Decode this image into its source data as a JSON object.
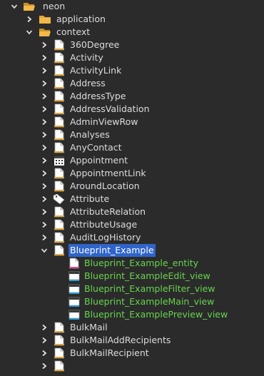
{
  "colors": {
    "background": "#2b2b2b",
    "text": "#dcdcdc",
    "selection": "#2f65ca",
    "generated_text": "#66d54d",
    "folder": "#e0a53a"
  },
  "rows": [
    {
      "label": "neon",
      "depth": 0,
      "arrow": "expanded",
      "icon": "folder-open-icon",
      "style": "normal"
    },
    {
      "label": "application",
      "depth": 1,
      "arrow": "collapsed",
      "icon": "folder-icon",
      "style": "normal"
    },
    {
      "label": "context",
      "depth": 1,
      "arrow": "expanded",
      "icon": "folder-open-icon",
      "style": "normal"
    },
    {
      "label": "360Degree",
      "depth": 2,
      "arrow": "collapsed",
      "icon": "context-icon",
      "style": "normal"
    },
    {
      "label": "Activity",
      "depth": 2,
      "arrow": "collapsed",
      "icon": "context-icon",
      "style": "normal"
    },
    {
      "label": "ActivityLink",
      "depth": 2,
      "arrow": "collapsed",
      "icon": "context-icon",
      "style": "normal"
    },
    {
      "label": "Address",
      "depth": 2,
      "arrow": "collapsed",
      "icon": "context-icon",
      "style": "normal"
    },
    {
      "label": "AddressType",
      "depth": 2,
      "arrow": "collapsed",
      "icon": "context-icon",
      "style": "normal"
    },
    {
      "label": "AddressValidation",
      "depth": 2,
      "arrow": "collapsed",
      "icon": "context-icon",
      "style": "normal"
    },
    {
      "label": "AdminViewRow",
      "depth": 2,
      "arrow": "collapsed",
      "icon": "context-icon",
      "style": "normal"
    },
    {
      "label": "Analyses",
      "depth": 2,
      "arrow": "collapsed",
      "icon": "context-icon",
      "style": "normal"
    },
    {
      "label": "AnyContact",
      "depth": 2,
      "arrow": "collapsed",
      "icon": "context-icon",
      "style": "normal"
    },
    {
      "label": "Appointment",
      "depth": 2,
      "arrow": "collapsed",
      "icon": "calendar-icon",
      "style": "normal"
    },
    {
      "label": "AppointmentLink",
      "depth": 2,
      "arrow": "collapsed",
      "icon": "context-icon",
      "style": "normal"
    },
    {
      "label": "AroundLocation",
      "depth": 2,
      "arrow": "collapsed",
      "icon": "context-icon",
      "style": "normal"
    },
    {
      "label": "Attribute",
      "depth": 2,
      "arrow": "collapsed",
      "icon": "tag-icon",
      "style": "normal"
    },
    {
      "label": "AttributeRelation",
      "depth": 2,
      "arrow": "collapsed",
      "icon": "context-icon",
      "style": "normal"
    },
    {
      "label": "AttributeUsage",
      "depth": 2,
      "arrow": "collapsed",
      "icon": "context-icon",
      "style": "normal"
    },
    {
      "label": "AuditLogHistory",
      "depth": 2,
      "arrow": "collapsed",
      "icon": "context-icon",
      "style": "normal"
    },
    {
      "label": "Blueprint_Example",
      "depth": 2,
      "arrow": "expanded",
      "icon": "context-icon",
      "style": "selected"
    },
    {
      "label": "Blueprint_Example_entity",
      "depth": 3,
      "arrow": "none",
      "icon": "entity-icon",
      "style": "green"
    },
    {
      "label": "Blueprint_ExampleEdit_view",
      "depth": 3,
      "arrow": "none",
      "icon": "view-icon",
      "style": "green"
    },
    {
      "label": "Blueprint_ExampleFilter_view",
      "depth": 3,
      "arrow": "none",
      "icon": "view-icon",
      "style": "green"
    },
    {
      "label": "Blueprint_ExampleMain_view",
      "depth": 3,
      "arrow": "none",
      "icon": "view-icon",
      "style": "green"
    },
    {
      "label": "Blueprint_ExamplePreview_view",
      "depth": 3,
      "arrow": "none",
      "icon": "view-icon",
      "style": "green"
    },
    {
      "label": "BulkMail",
      "depth": 2,
      "arrow": "collapsed",
      "icon": "context-icon",
      "style": "normal"
    },
    {
      "label": "BulkMailAddRecipients",
      "depth": 2,
      "arrow": "collapsed",
      "icon": "context-icon",
      "style": "normal"
    },
    {
      "label": "BulkMailRecipient",
      "depth": 2,
      "arrow": "collapsed",
      "icon": "context-icon",
      "style": "normal"
    },
    {
      "label": "",
      "depth": 2,
      "arrow": "collapsed",
      "icon": "context-icon",
      "style": "normal"
    }
  ]
}
